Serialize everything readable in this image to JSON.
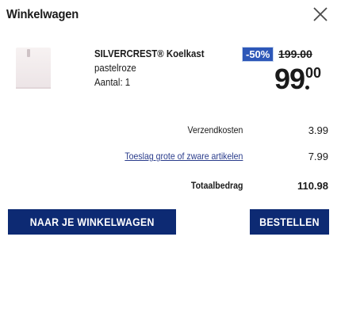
{
  "header": {
    "title": "Winkelwagen",
    "close_icon": "close-icon"
  },
  "item": {
    "name": "SILVERCREST® Koelkast",
    "variant": "pastelroze",
    "quantity_label": "Aantal: 1",
    "discount_badge": "-50%",
    "old_price": "199.00",
    "new_price_whole": "99",
    "new_price_cents": "00"
  },
  "summary": {
    "shipping_label": "Verzendkosten",
    "shipping_value": "3.99",
    "surcharge_label": "Toeslag grote of zware artikelen",
    "surcharge_value": "7.99",
    "total_label": "Totaalbedrag",
    "total_value": "110.98"
  },
  "buttons": {
    "cart_label": "NAAR JE WINKELWAGEN",
    "order_label": "BESTELLEN"
  },
  "colors": {
    "primary": "#0d2a73",
    "badge": "#2d57b8",
    "link": "#2a3c8c"
  }
}
